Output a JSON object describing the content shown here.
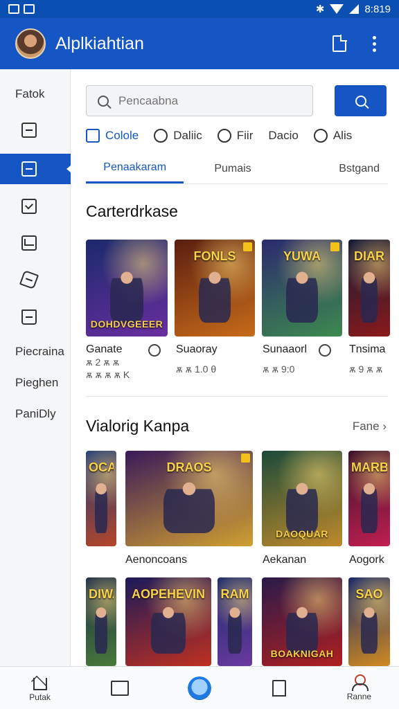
{
  "status_bar": {
    "time": "8:819"
  },
  "app_bar": {
    "title": "Alplkiahtian"
  },
  "sidebar": {
    "top_label": "Fatok",
    "icons": [
      "box-icon",
      "inbox-icon",
      "check-icon",
      "mail-icon",
      "puzzle-icon",
      "bag-icon"
    ],
    "active_index": 1,
    "bottom_labels": [
      "Piecraina",
      "Pieghen",
      "PaniDly"
    ]
  },
  "search": {
    "placeholder": "Pencaabna"
  },
  "filters": [
    {
      "label": "Cololе",
      "active": true
    },
    {
      "label": "Daliic",
      "active": false
    },
    {
      "label": "Fiir",
      "active": false
    },
    {
      "label": "Dacio",
      "active": false
    },
    {
      "label": "Alis",
      "active": false
    }
  ],
  "tabs": [
    {
      "label": "Penaakaram",
      "active": true
    },
    {
      "label": "Pumais",
      "active": false
    },
    {
      "label": "Bstgand",
      "active": false
    }
  ],
  "section1": {
    "title": "Carterdrkase",
    "cards": [
      {
        "art_title": "DOHDVGEEER",
        "name": "Ganate",
        "rating": "ѫ 2 ѫ ѫ",
        "rating2": "ѫ ѫ ѫ ѫ K",
        "colors": [
          "#1a2a6b",
          "#6a2ea0"
        ]
      },
      {
        "art_title": "FONLS",
        "name": "Suaoray",
        "rating": "ѫ ѫ 1.0 θ",
        "colors": [
          "#5a1e0f",
          "#c76b1a"
        ]
      },
      {
        "art_title": "YUWA",
        "name": "Sunaaorl",
        "rating": "ѫ ѫ 9:0",
        "colors": [
          "#2b2a6e",
          "#3d8a4e"
        ]
      },
      {
        "art_title": "DIAR",
        "name": "Tnsima",
        "rating": "ѫ 9 ѫ ѫ",
        "colors": [
          "#101a3a",
          "#8a1a1a"
        ]
      }
    ]
  },
  "section2": {
    "title": "Vialorig Kanpa",
    "see_more": "Fane",
    "row1": [
      {
        "art_title": "OCAD",
        "name": "",
        "colors": [
          "#1a3a7a",
          "#b5462a"
        ]
      },
      {
        "art_title": "DRAOS",
        "name": "Aenoncoans",
        "colors": [
          "#3a1a5a",
          "#d0a030"
        ]
      },
      {
        "art_title": "DAOQUAR",
        "name": "Aekanan",
        "colors": [
          "#1a4a3a",
          "#c08a2a"
        ]
      },
      {
        "art_title": "MARBOR",
        "name": "Aogork",
        "colors": [
          "#3a0f2a",
          "#c02050"
        ]
      }
    ],
    "row2": [
      {
        "art_title": "DIWAN",
        "colors": [
          "#1a2a4a",
          "#4a7a3a"
        ]
      },
      {
        "art_title": "AOPEHEVIN",
        "colors": [
          "#1a1a5a",
          "#c03020"
        ]
      },
      {
        "art_title": "RAM",
        "colors": [
          "#1a2a6a",
          "#6a3aa0"
        ]
      },
      {
        "art_title": "BOAKNIGAH",
        "colors": [
          "#2a1a4a",
          "#b02020"
        ]
      },
      {
        "art_title": "SAO",
        "colors": [
          "#1a2a6a",
          "#d08a20"
        ]
      }
    ]
  },
  "bottom_nav": [
    {
      "label": "Putak",
      "icon": "home-icon"
    },
    {
      "label": "",
      "icon": "grid-icon"
    },
    {
      "label": "",
      "icon": "center-circle-icon"
    },
    {
      "label": "",
      "icon": "bookmark-icon"
    },
    {
      "label": "Ranne",
      "icon": "user-icon"
    }
  ]
}
